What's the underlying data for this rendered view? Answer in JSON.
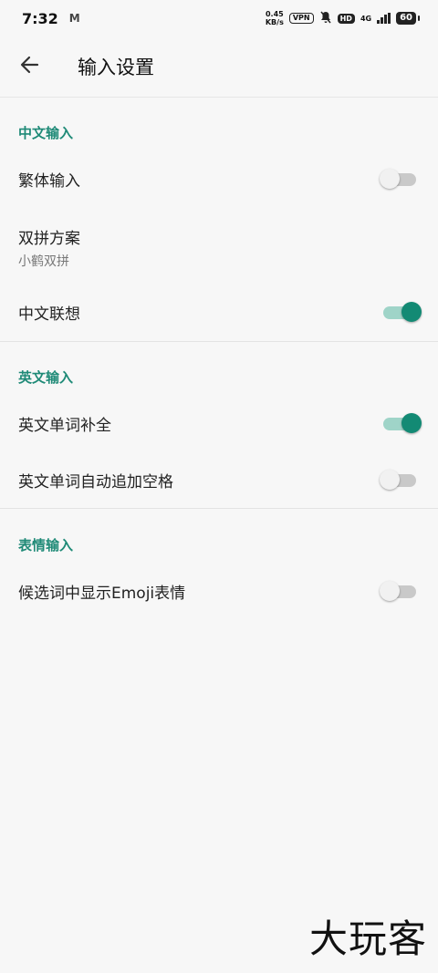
{
  "status_bar": {
    "time": "7:32",
    "notif": "M",
    "speed_value": "0.45",
    "speed_unit": "KB/s",
    "vpn": "VPN",
    "hd": "HD",
    "network": "4G",
    "battery": "60"
  },
  "app_bar": {
    "title": "输入设置",
    "back_icon": "arrow-left-icon"
  },
  "sections": {
    "chinese": {
      "header": "中文输入",
      "traditional": {
        "label": "繁体输入",
        "enabled": false
      },
      "shuangpin": {
        "label": "双拼方案",
        "value": "小鹤双拼"
      },
      "association": {
        "label": "中文联想",
        "enabled": true
      }
    },
    "english": {
      "header": "英文输入",
      "completion": {
        "label": "英文单词补全",
        "enabled": true
      },
      "auto_space": {
        "label": "英文单词自动追加空格",
        "enabled": false
      }
    },
    "emoji": {
      "header": "表情输入",
      "show_emoji": {
        "label": "候选词中显示Emoji表情",
        "enabled": false
      }
    }
  },
  "watermark": "大玩客",
  "colors": {
    "accent": "#138a74",
    "section_header": "#1f8a77",
    "background": "#f7f7f7"
  }
}
